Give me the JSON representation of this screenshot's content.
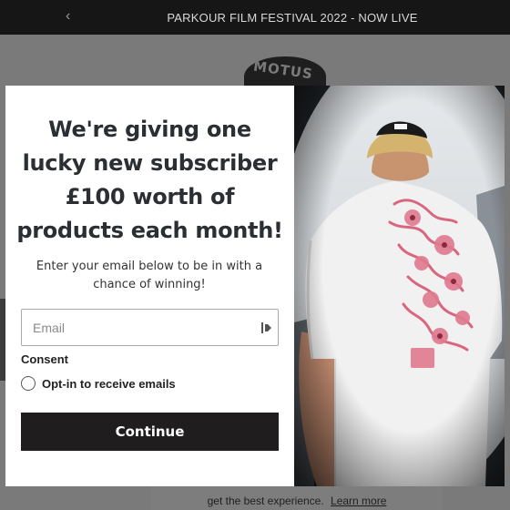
{
  "announcement": {
    "text": "PARKOUR FILM FESTIVAL 2022 - NOW LIVE",
    "prev_glyph": "‹"
  },
  "site": {
    "logo_text": "MOTUS",
    "cookie_text": "get the best experience.",
    "cookie_link": "Learn more"
  },
  "popup": {
    "headline": "We're giving one lucky new subscriber £100 worth of products each month!",
    "subtext": "Enter your email below to be in with a chance of winning!",
    "email_placeholder": "Email",
    "email_value": "",
    "consent_label": "Consent",
    "optin_label": "Opt-in to receive emails",
    "continue_label": "Continue",
    "image_description_icon": "photo-person-in-white-tshirt"
  },
  "colors": {
    "announcement_bg": "#161616",
    "button_bg": "#1f1d1d",
    "headline": "#2b2f33",
    "shirt_print": "#e0798f"
  }
}
